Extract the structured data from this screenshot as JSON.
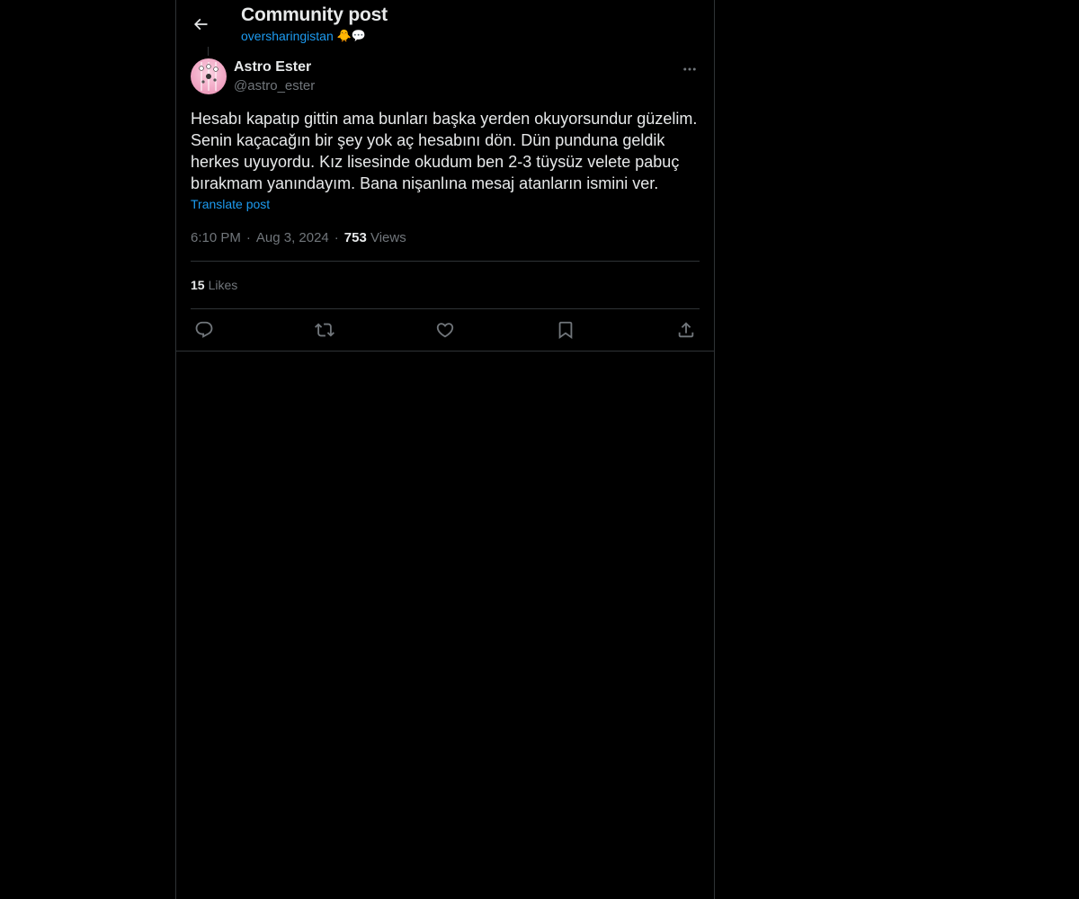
{
  "header": {
    "title": "Community post",
    "community": "oversharingistan",
    "community_emoji": "🐥💬"
  },
  "post": {
    "author_name": "Astro Ester",
    "author_handle": "@astro_ester",
    "text": "Hesabı kapatıp gittin ama bunları başka yerden okuyorsundur güzelim.\nSenin kaçacağın bir şey yok aç hesabını dön. Dün punduna geldik\nherkes uyuyordu. Kız lisesinde okudum ben 2-3 tüysüz velete pabuç\nbırakmam yanındayım. Bana nişanlına mesaj atanların ismini ver.",
    "translate_label": "Translate post",
    "time": "6:10 PM",
    "date": "Aug 3, 2024",
    "views_count": "753",
    "views_label": "Views",
    "likes_count": "15",
    "likes_label": "Likes"
  },
  "icons": {
    "back": "arrow-left-icon",
    "more": "more-horizontal-icon",
    "reply": "reply-icon",
    "repost": "repost-icon",
    "like": "heart-icon",
    "bookmark": "bookmark-icon",
    "share": "share-icon"
  },
  "colors": {
    "background": "#000000",
    "text_primary": "#e7e9ea",
    "text_secondary": "#71767b",
    "accent": "#1d9bf0",
    "border": "#2f3336"
  }
}
